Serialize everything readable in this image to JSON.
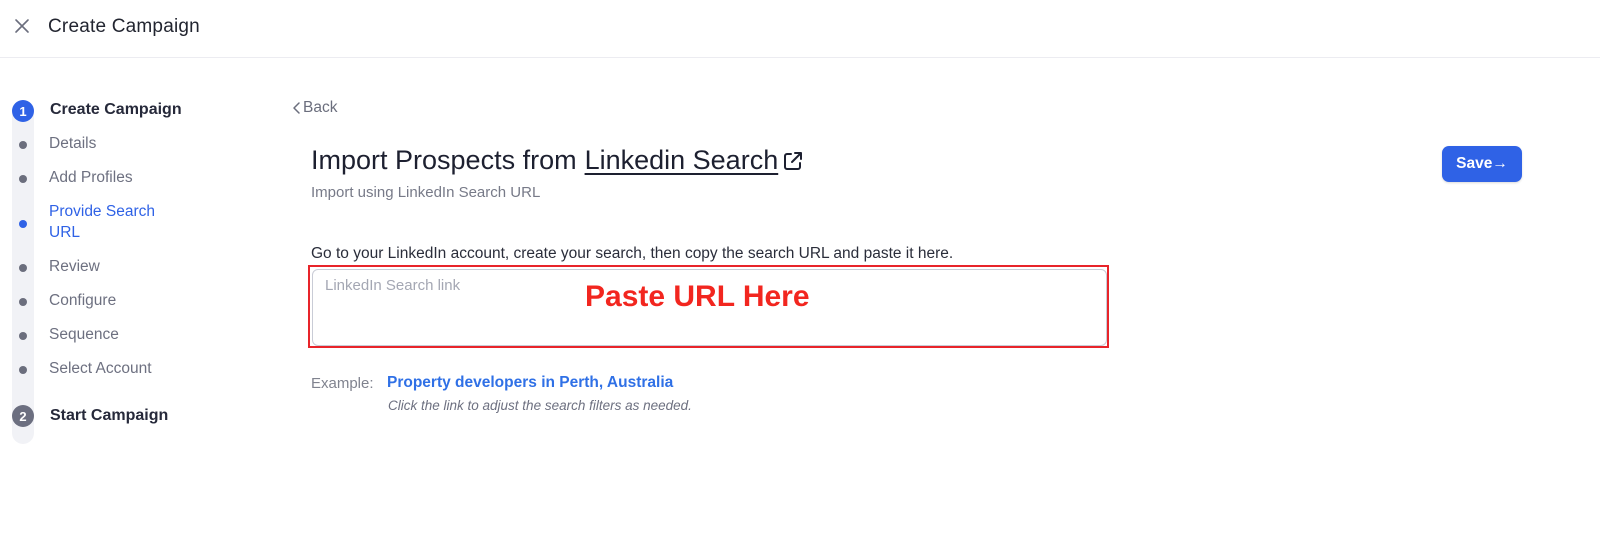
{
  "header": {
    "title": "Create Campaign"
  },
  "stepper": {
    "step1": {
      "number": "1",
      "label": "Create Campaign"
    },
    "items": [
      {
        "label": "Details"
      },
      {
        "label": "Add Profiles"
      },
      {
        "label": "Provide Search URL"
      },
      {
        "label": "Review"
      },
      {
        "label": "Configure"
      },
      {
        "label": "Sequence"
      },
      {
        "label": "Select Account"
      }
    ],
    "step2": {
      "number": "2",
      "label": "Start Campaign"
    }
  },
  "main": {
    "back_label": "Back",
    "title_prefix": "Import Prospects from",
    "title_link": "Linkedin Search",
    "subtitle": "Import using LinkedIn Search URL",
    "save_label": "Save→",
    "instructions": "Go to your LinkedIn account, create your search, then copy the search URL and paste it here.",
    "input_placeholder": "LinkedIn Search link",
    "annotation": "Paste URL Here",
    "example_label": "Example:",
    "example_link": "Property developers in Perth, Australia",
    "example_hint": "Click the link to adjust the search filters as needed."
  },
  "colors": {
    "accent": "#2f62e6",
    "annotation_red": "#f2261f"
  }
}
